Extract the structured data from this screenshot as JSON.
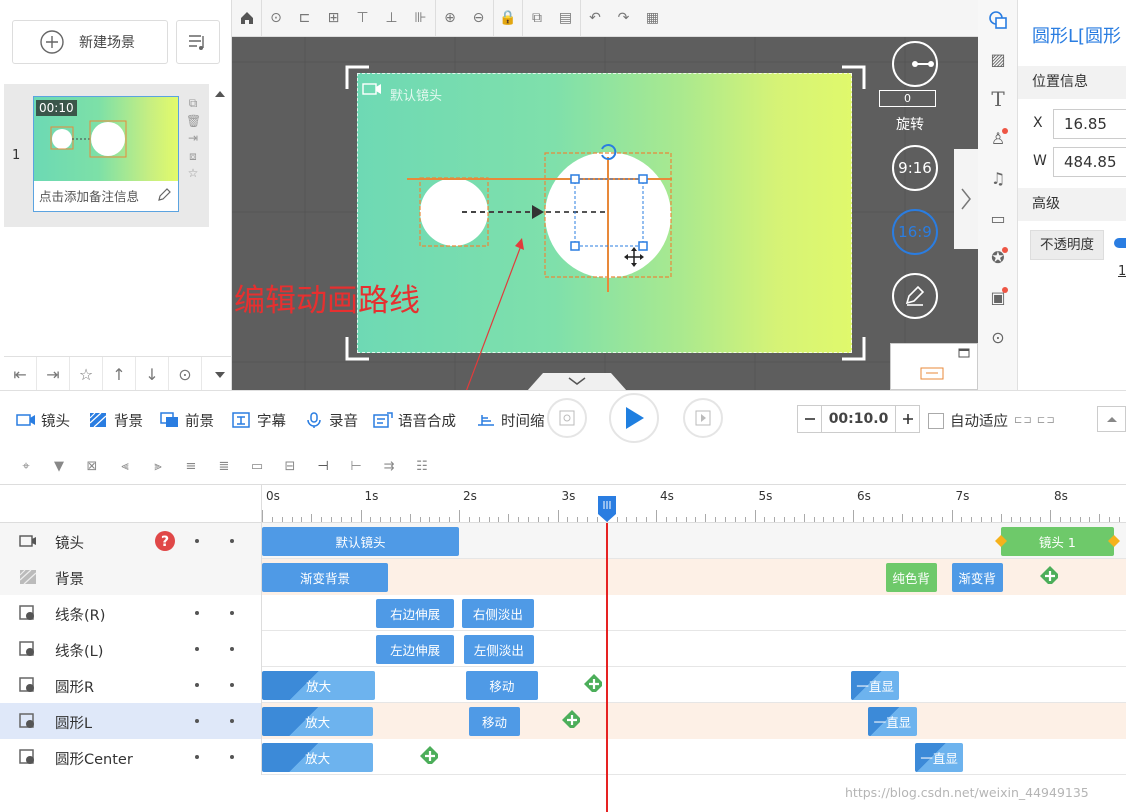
{
  "left_panel": {
    "new_scene_label": "新建场景",
    "scene_number": "1",
    "scene_duration": "00:10",
    "scene_note": "点击添加备注信息"
  },
  "canvas": {
    "camera_label": "默认镜头",
    "annotation": "编辑动画路线",
    "rotate_value": "0",
    "rotate_label": "旋转",
    "ratio_916": "9:16",
    "ratio_169": "16:9"
  },
  "right_panel": {
    "title": "圆形L[圆形",
    "position_section": "位置信息",
    "x_label": "X",
    "x_value": "16.85",
    "w_label": "W",
    "w_value": "484.85",
    "advanced_section": "高级",
    "opacity_label": "不透明度",
    "opacity_value": "1"
  },
  "mid_toolbar": {
    "tracks": [
      "镜头",
      "背景",
      "前景",
      "字幕",
      "录音",
      "语音合成",
      "时间缩"
    ],
    "time_value": "00:10.0",
    "auto_fit_label": "自动适应"
  },
  "timeline": {
    "ruler_labels": [
      "0s",
      "1s",
      "2s",
      "3s",
      "4s",
      "5s",
      "6s",
      "7s",
      "8s"
    ],
    "playhead_seconds": 3.5,
    "rows": [
      {
        "name": "镜头",
        "blocks": [
          {
            "label": "默认镜头",
            "start": 0,
            "end": 2.0
          },
          {
            "label": "镜头 1",
            "start": 7.5,
            "end": 8.65,
            "color": "green"
          }
        ]
      },
      {
        "name": "背景",
        "blocks": [
          {
            "label": "渐变背景",
            "start": 0,
            "end": 1.28
          },
          {
            "label": "纯色背",
            "start": 6.33,
            "end": 6.85,
            "color": "green"
          },
          {
            "label": "渐变背",
            "start": 7.0,
            "end": 7.52
          }
        ],
        "plus_at": 7.9
      },
      {
        "name": "线条(R)",
        "blocks": [
          {
            "label": "右边伸展",
            "start": 1.16,
            "end": 1.95
          },
          {
            "label": "右侧淡出",
            "start": 2.03,
            "end": 2.76
          }
        ]
      },
      {
        "name": "线条(L)",
        "blocks": [
          {
            "label": "左边伸展",
            "start": 1.16,
            "end": 1.95
          },
          {
            "label": "左侧淡出",
            "start": 2.05,
            "end": 2.76
          }
        ]
      },
      {
        "name": "圆形R",
        "blocks": [
          {
            "label": "放大",
            "start": 0,
            "end": 1.15,
            "anim": true
          },
          {
            "label": "移动",
            "start": 2.07,
            "end": 2.8
          },
          {
            "label": "一直显",
            "start": 5.98,
            "end": 6.47,
            "anim": true
          }
        ],
        "plus_at": 3.27
      },
      {
        "name": "圆形L",
        "blocks": [
          {
            "label": "放大",
            "start": 0,
            "end": 1.13,
            "anim": true
          },
          {
            "label": "移动",
            "start": 2.1,
            "end": 2.62
          },
          {
            "label": "一直显",
            "start": 6.15,
            "end": 6.65,
            "anim": true
          }
        ],
        "plus_at": 3.05,
        "selected": true
      },
      {
        "name": "圆形Center",
        "blocks": [
          {
            "label": "放大",
            "start": 0,
            "end": 1.13,
            "anim": true
          },
          {
            "label": "一直显",
            "start": 6.63,
            "end": 7.12,
            "anim": true
          }
        ],
        "plus_at": 1.6
      }
    ]
  },
  "watermark": "https://blog.csdn.net/weixin_44949135",
  "colors": {
    "accent": "#2a7de1",
    "block": "#4f9ae6",
    "block_green": "#6ec96a",
    "playhead": "#e62222",
    "annotation": "#e63030"
  }
}
